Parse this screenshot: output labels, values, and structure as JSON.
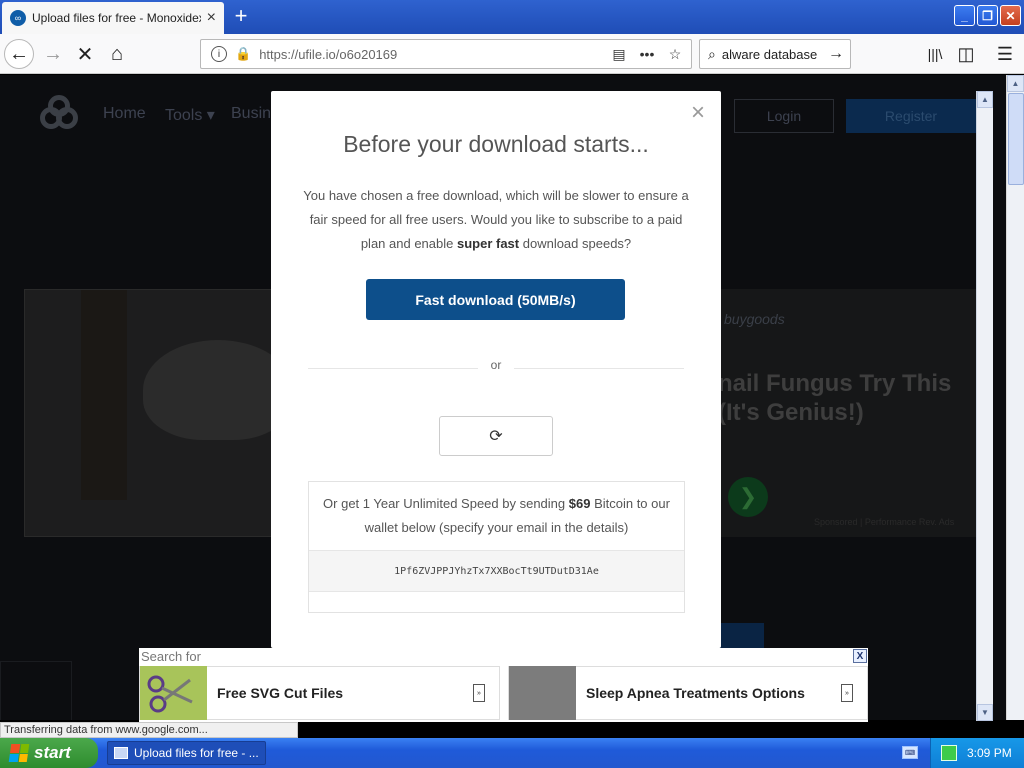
{
  "browser": {
    "tab": {
      "favicon": "ufile-logo-icon",
      "title": "Upload files for free - Monoxidex8",
      "close": "×"
    },
    "new_tab": "+",
    "window_controls": {
      "minimize": "_",
      "restore": "❐",
      "close": "✕"
    },
    "nav": {
      "back": "←",
      "forward": "→",
      "stop": "✕",
      "home": "⌂"
    },
    "url": "https://ufile.io/o6o20169",
    "url_actions": {
      "reader": "▤",
      "more": "•••",
      "bookmark": "☆"
    },
    "search_value": "alware database",
    "toolbar": {
      "library": "|||\\",
      "sidebar": "◫",
      "menu": "☰"
    }
  },
  "site": {
    "nav": [
      "Home",
      "Tools ▾",
      "Busin"
    ],
    "login": "Login",
    "register": "Register",
    "ad_right": {
      "brand": "buygoods",
      "headline_1": "nail Fungus Try This",
      "headline_2": "(It's Genius!)",
      "go": "❯",
      "fineprint": "Sponsored | Performance Rev. Ads"
    }
  },
  "modal": {
    "close": "×",
    "title": "Before your download starts...",
    "desc_1": "You have chosen a free download, which will be slower to ensure a fair speed for all free users. Would you like to subscribe to a paid plan and enable ",
    "desc_bold": "super fast",
    "desc_2": " download speeds?",
    "fast_button": "Fast download (50MB/s)",
    "or": "or",
    "reload_icon": "⟳",
    "btc_1": "Or get 1 Year Unlimited Speed by sending ",
    "btc_price": "$69",
    "btc_2": " Bitcoin to our wallet below (specify your email in the details)",
    "wallet": "1Pf6ZVJPPJYhzTx7XXBocTt9UTDutD31Ae"
  },
  "ad_banner": {
    "search_for": "Search for",
    "close": "X",
    "items": [
      {
        "label": "Free SVG Cut Files",
        "arrow": "»"
      },
      {
        "label": "Sleep Apnea Treatments Options",
        "arrow": "»"
      }
    ]
  },
  "status_bar": "Transferring data from www.google.com...",
  "taskbar": {
    "start": "start",
    "task": "Upload files for free - ...",
    "time": "3:09 PM"
  },
  "colors": {
    "fast_button": "#0d4f8b",
    "taskbar": "#2358cf",
    "start_button": "#2e8c2e",
    "overlay": "#0c0d10"
  }
}
